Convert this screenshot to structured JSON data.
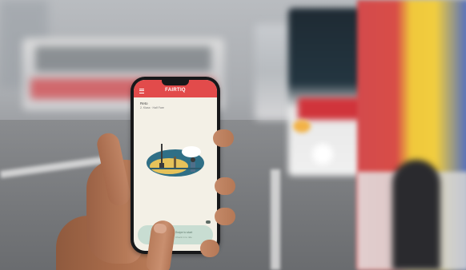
{
  "scene": {
    "description_subject": "phone-with-transit-ticket-app",
    "colors": {
      "app_accent": "#e24b4b",
      "screen_background": "#f3f0e6",
      "panel_green": "#c8ddd2"
    }
  },
  "phone_app": {
    "brand": "FAIRTIQ",
    "ticket": {
      "name": "Reto",
      "detail": "2. Klass · Half Fare"
    },
    "illustration_icon": "city-scene-icon",
    "panel": {
      "line1": "Swipe to start",
      "line2": "Check in to ride"
    }
  }
}
